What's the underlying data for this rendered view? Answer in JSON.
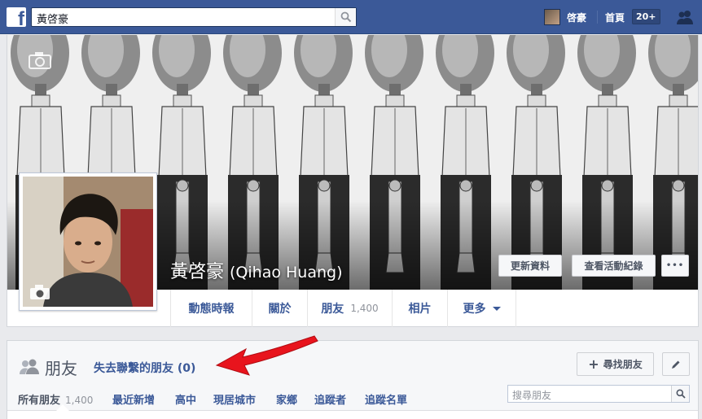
{
  "topbar": {
    "search_value": "黃啓豪",
    "user_name": "啓豪",
    "home_label": "首頁",
    "notification_badge": "20+"
  },
  "profile": {
    "name_cjk": "黃啓豪",
    "name_latin": "(Qihao Huang)",
    "update_info_label": "更新資料",
    "activity_log_label": "查看活動紀錄",
    "more_label": "•••"
  },
  "nav": {
    "items": [
      {
        "label": "動態時報"
      },
      {
        "label": "關於"
      },
      {
        "label": "朋友",
        "count": "1,400"
      },
      {
        "label": "相片"
      },
      {
        "label": "更多"
      }
    ]
  },
  "friends": {
    "title": "朋友",
    "lost_contact": "失去聯繫的朋友 (0)",
    "find_friends_label": "尋找朋友",
    "tabs": [
      {
        "label": "所有朋友",
        "count": "1,400"
      },
      {
        "label": "最近新增"
      },
      {
        "label": "高中"
      },
      {
        "label": "現居城市"
      },
      {
        "label": "家鄉"
      },
      {
        "label": "追蹤者"
      },
      {
        "label": "追蹤名單"
      }
    ],
    "search_placeholder": "搜尋朋友"
  },
  "colors": {
    "brand": "#3b5998",
    "annotation_arrow": "#e8141d"
  }
}
